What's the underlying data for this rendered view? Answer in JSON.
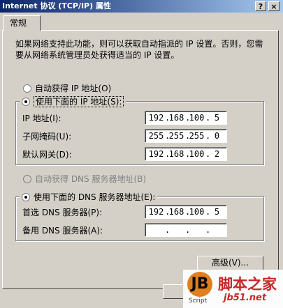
{
  "window": {
    "title": "Internet 协议 (TCP/IP) 属性",
    "help_btn": "?",
    "close_btn": "×"
  },
  "tabs": [
    {
      "label": "常规"
    }
  ],
  "description": "如果网络支持此功能，则可以获取自动指派的 IP 设置。否则，您需要从网络系统管理员处获得适当的 IP 设置。",
  "ip": {
    "auto_label": "自动获得 IP 地址(O)",
    "manual_label": "使用下面的 IP 地址(S):",
    "selected": "manual",
    "fields": [
      {
        "label": "IP 地址(I):",
        "octets": [
          "192",
          "168",
          "100",
          "5"
        ]
      },
      {
        "label": "子网掩码(U):",
        "octets": [
          "255",
          "255",
          "255",
          "0"
        ]
      },
      {
        "label": "默认网关(D):",
        "octets": [
          "192",
          "168",
          "100",
          "2"
        ]
      }
    ]
  },
  "dns": {
    "auto_label": "自动获得 DNS 服务器地址(B)",
    "manual_label": "使用下面的 DNS 服务器地址(E):",
    "selected": "manual",
    "fields": [
      {
        "label": "首选 DNS 服务器(P):",
        "octets": [
          "192",
          "168",
          "100",
          "5"
        ]
      },
      {
        "label": "备用 DNS 服务器(A):",
        "octets": [
          "",
          "",
          "",
          ""
        ]
      }
    ]
  },
  "buttons": {
    "advanced": "高级(V)..."
  },
  "watermark": {
    "logo": "JB",
    "script": "Script",
    "name": "脚本之家",
    "url": "jb51.net"
  }
}
